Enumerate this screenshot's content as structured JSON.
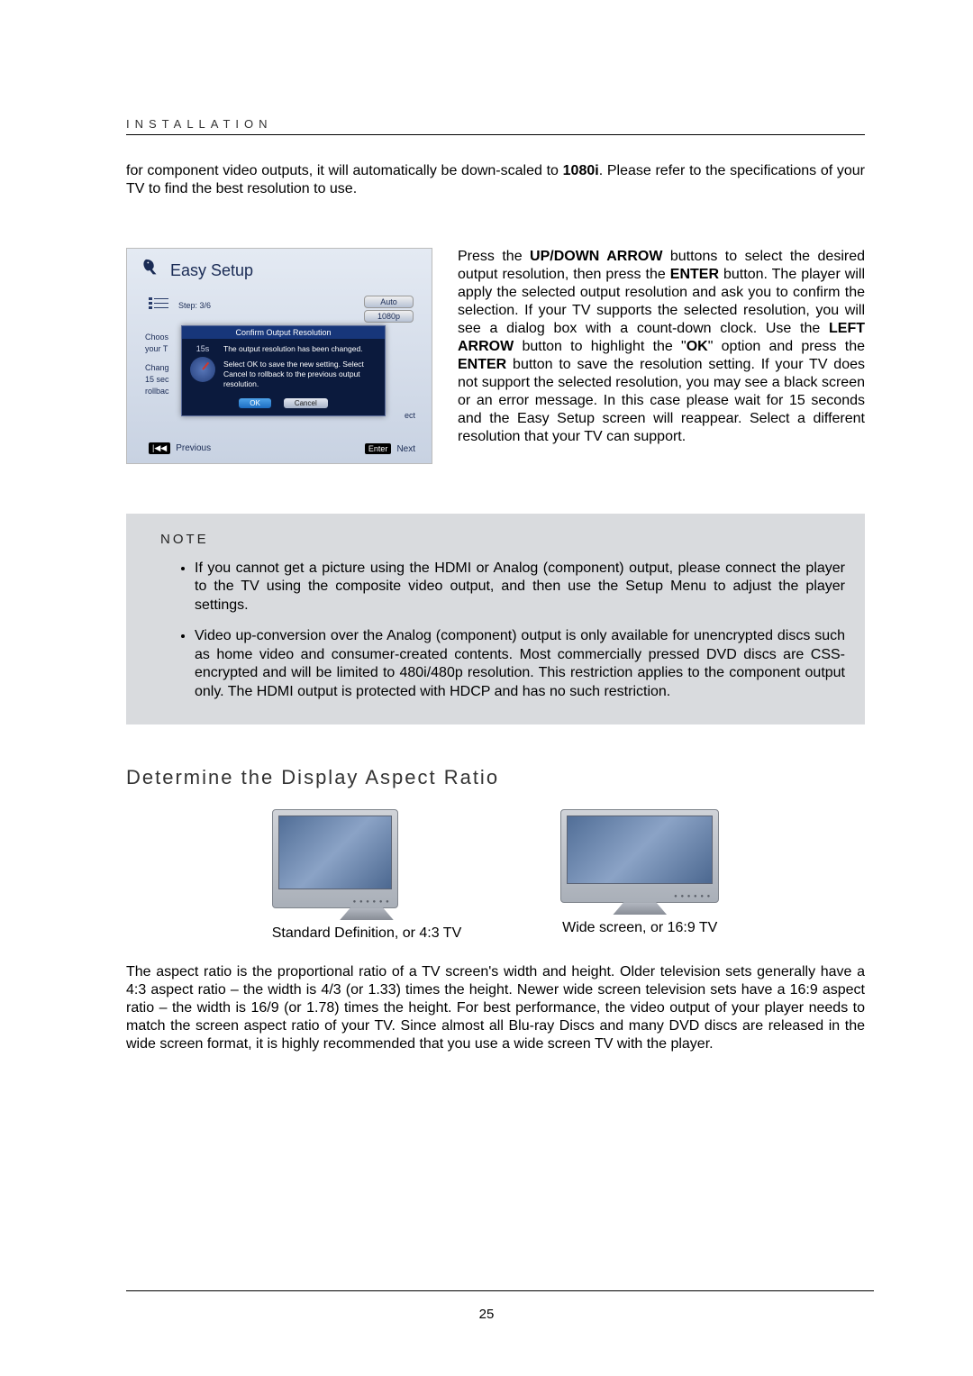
{
  "header": {
    "section_label": "INSTALLATION"
  },
  "intro": {
    "text_a": "for component video outputs, it will automatically be down-scaled to ",
    "bold_1080i": "1080i",
    "text_b": ".  Please refer to the specifications of your TV to find the best resolution to use."
  },
  "setup": {
    "title": "Easy Setup",
    "step": "Step: 3/6",
    "option_auto": "Auto",
    "option_1080p": "1080p",
    "left_trunc_1": "Choos",
    "left_trunc_2": "your T",
    "left_trunc_3": "Chang",
    "left_trunc_4": "15 sec",
    "left_trunc_5": "rollbac",
    "right_trunc": "ect",
    "modal": {
      "title": "Confirm Output Resolution",
      "countdown": "15s",
      "line1": "The output resolution has been changed.",
      "line2": "Select OK to save the new setting. Select Cancel to rollback to the previous output resolution.",
      "ok": "OK",
      "cancel": "Cancel"
    },
    "footer": {
      "prev_key": "|◀◀",
      "prev_label": "Previous",
      "enter_key": "Enter",
      "next_label": "Next"
    }
  },
  "right_para": {
    "t1": "Press the ",
    "b1": "UP/DOWN ARROW",
    "t2": " buttons to select the desired output resolution, then press the ",
    "b2": "ENTER",
    "t3": " button.  The player will apply the selected output resolution and ask you to confirm the selection.  If your TV supports the selected resolution, you will see a dialog box with a count-down clock.  Use the ",
    "b3": "LEFT ARROW",
    "t4": " button to highlight the \"",
    "b4": "OK",
    "t5": "\" option and press the ",
    "b5": "ENTER",
    "t6": " button to save the resolution setting.  If your TV does not support the selected resolution, you may see a black screen or an error message.  In this case please wait for 15 seconds and the Easy Setup screen will reappear.  Select a different resolution that your TV can support."
  },
  "note": {
    "title": "NOTE",
    "item1": "If you cannot get a picture using the HDMI or Analog (component) output, please connect the player to the TV using the composite video output, and then use the Setup Menu to adjust the player settings.",
    "item2": "Video up-conversion over the Analog (component) output is only available for unencrypted discs such as home video and consumer-created contents.  Most commercially pressed DVD discs are CSS-encrypted and will be limited to 480i/480p resolution.  This restriction applies to the component output only.  The HDMI output is protected with HDCP and has no such restriction."
  },
  "section2": {
    "heading": "Determine the Display Aspect Ratio",
    "tv1_caption": "Standard Definition, or 4:3 TV",
    "tv2_caption": "Wide screen, or 16:9 TV",
    "para": "The aspect ratio is the proportional ratio of a TV screen's width and height.  Older television sets generally have a 4:3 aspect ratio – the width is 4/3 (or 1.33) times the height.  Newer wide screen television sets have a 16:9 aspect ratio – the width is 16/9 (or 1.78) times the height.  For best performance, the video output of your player needs to match the screen aspect ratio of your TV.  Since almost all Blu-ray Discs and many DVD discs are released in the wide screen format, it is highly recommended that you use a wide screen TV with the player."
  },
  "page_number": "25"
}
